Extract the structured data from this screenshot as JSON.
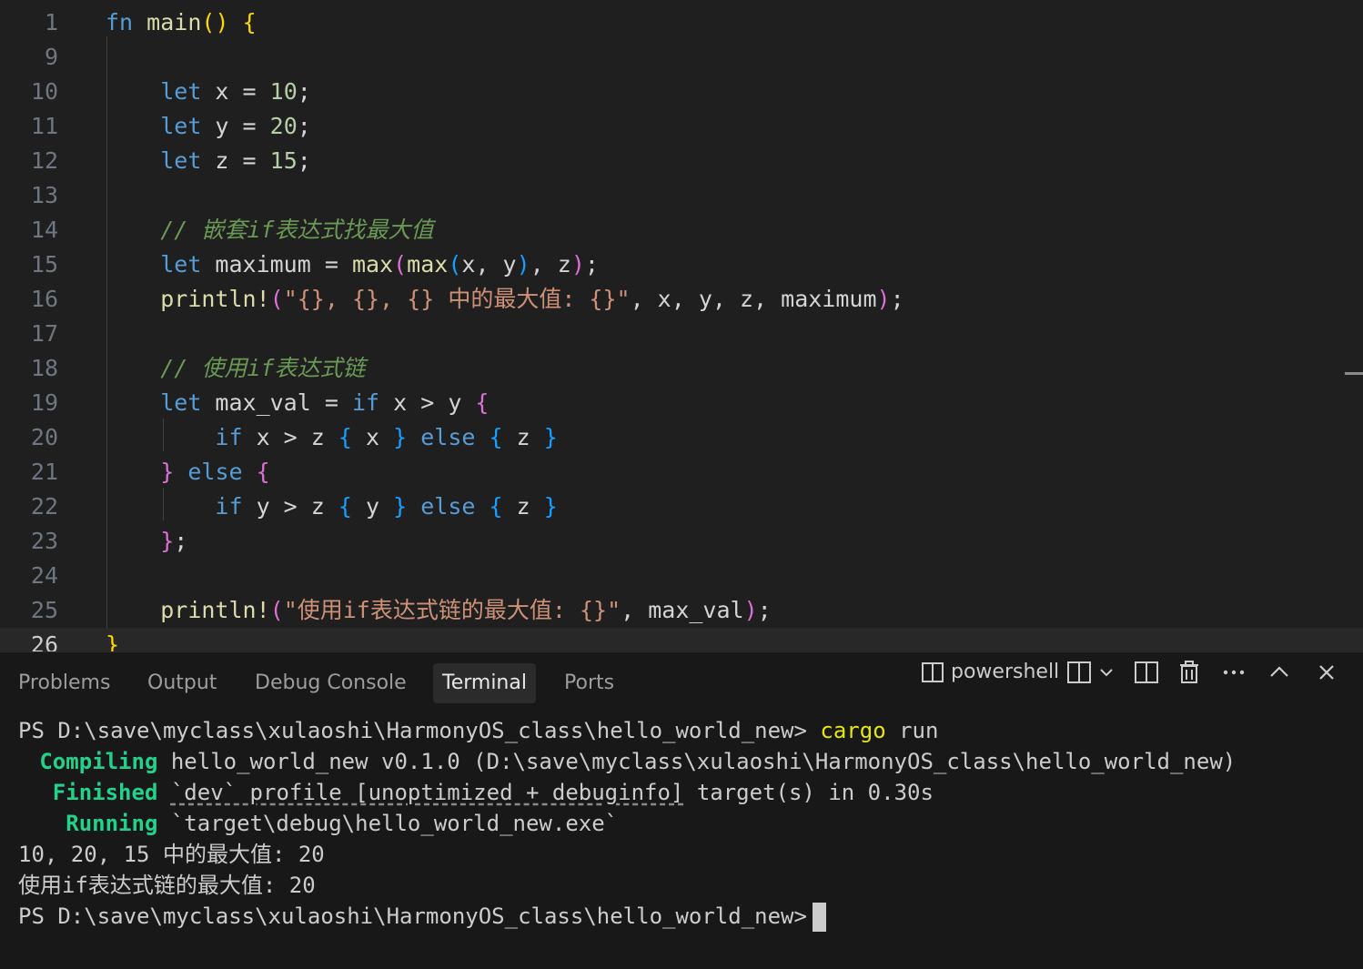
{
  "editor": {
    "lines": [
      {
        "n": "1",
        "code": [
          [
            "kw",
            "fn"
          ],
          [
            "id",
            " "
          ],
          [
            "fn",
            "main"
          ],
          [
            "b1",
            "()"
          ],
          [
            "id",
            " "
          ],
          [
            "b1",
            "{"
          ]
        ]
      },
      {
        "n": "9",
        "code": []
      },
      {
        "n": "10",
        "code": [
          [
            "id",
            "    "
          ],
          [
            "kw",
            "let"
          ],
          [
            "id",
            " x = "
          ],
          [
            "num",
            "10"
          ],
          [
            "punc",
            ";"
          ]
        ]
      },
      {
        "n": "11",
        "code": [
          [
            "id",
            "    "
          ],
          [
            "kw",
            "let"
          ],
          [
            "id",
            " y = "
          ],
          [
            "num",
            "20"
          ],
          [
            "punc",
            ";"
          ]
        ]
      },
      {
        "n": "12",
        "code": [
          [
            "id",
            "    "
          ],
          [
            "kw",
            "let"
          ],
          [
            "id",
            " z = "
          ],
          [
            "num",
            "15"
          ],
          [
            "punc",
            ";"
          ]
        ]
      },
      {
        "n": "13",
        "code": []
      },
      {
        "n": "14",
        "code": [
          [
            "id",
            "    "
          ],
          [
            "cm",
            "// 嵌套if表达式找最大值"
          ]
        ]
      },
      {
        "n": "15",
        "code": [
          [
            "id",
            "    "
          ],
          [
            "kw",
            "let"
          ],
          [
            "id",
            " maximum = "
          ],
          [
            "fn",
            "max"
          ],
          [
            "b2",
            "("
          ],
          [
            "fn",
            "max"
          ],
          [
            "b3",
            "("
          ],
          [
            "id",
            "x, y"
          ],
          [
            "b3",
            ")"
          ],
          [
            "id",
            ", z"
          ],
          [
            "b2",
            ")"
          ],
          [
            "punc",
            ";"
          ]
        ]
      },
      {
        "n": "16",
        "code": [
          [
            "id",
            "    "
          ],
          [
            "mac",
            "println!"
          ],
          [
            "b2",
            "("
          ],
          [
            "str",
            "\"{}, {}, {} 中的最大值: {}\""
          ],
          [
            "id",
            ", x, y, z, maximum"
          ],
          [
            "b2",
            ")"
          ],
          [
            "punc",
            ";"
          ]
        ]
      },
      {
        "n": "17",
        "code": []
      },
      {
        "n": "18",
        "code": [
          [
            "id",
            "    "
          ],
          [
            "cm",
            "// 使用if表达式链"
          ]
        ]
      },
      {
        "n": "19",
        "code": [
          [
            "id",
            "    "
          ],
          [
            "kw",
            "let"
          ],
          [
            "id",
            " max_val = "
          ],
          [
            "kw",
            "if"
          ],
          [
            "id",
            " x > y "
          ],
          [
            "b2",
            "{"
          ]
        ]
      },
      {
        "n": "20",
        "code": [
          [
            "id",
            "        "
          ],
          [
            "kw",
            "if"
          ],
          [
            "id",
            " x > z "
          ],
          [
            "b3",
            "{"
          ],
          [
            "id",
            " x "
          ],
          [
            "b3",
            "}"
          ],
          [
            "id",
            " "
          ],
          [
            "kw",
            "else"
          ],
          [
            "id",
            " "
          ],
          [
            "b3",
            "{"
          ],
          [
            "id",
            " z "
          ],
          [
            "b3",
            "}"
          ]
        ]
      },
      {
        "n": "21",
        "code": [
          [
            "id",
            "    "
          ],
          [
            "b2",
            "}"
          ],
          [
            "id",
            " "
          ],
          [
            "kw",
            "else"
          ],
          [
            "id",
            " "
          ],
          [
            "b2",
            "{"
          ]
        ]
      },
      {
        "n": "22",
        "code": [
          [
            "id",
            "        "
          ],
          [
            "kw",
            "if"
          ],
          [
            "id",
            " y > z "
          ],
          [
            "b3",
            "{"
          ],
          [
            "id",
            " y "
          ],
          [
            "b3",
            "}"
          ],
          [
            "id",
            " "
          ],
          [
            "kw",
            "else"
          ],
          [
            "id",
            " "
          ],
          [
            "b3",
            "{"
          ],
          [
            "id",
            " z "
          ],
          [
            "b3",
            "}"
          ]
        ]
      },
      {
        "n": "23",
        "code": [
          [
            "id",
            "    "
          ],
          [
            "b2",
            "}"
          ],
          [
            "punc",
            ";"
          ]
        ]
      },
      {
        "n": "24",
        "code": []
      },
      {
        "n": "25",
        "code": [
          [
            "id",
            "    "
          ],
          [
            "mac",
            "println!"
          ],
          [
            "b2",
            "("
          ],
          [
            "str",
            "\"使用if表达式链的最大值: {}\""
          ],
          [
            "id",
            ", max_val"
          ],
          [
            "b2",
            ")"
          ],
          [
            "punc",
            ";"
          ]
        ]
      },
      {
        "n": "26",
        "code": [
          [
            "b1",
            "}"
          ]
        ],
        "current": true
      }
    ]
  },
  "panel": {
    "tabs": [
      {
        "label": "Problems",
        "active": false
      },
      {
        "label": "Output",
        "active": false
      },
      {
        "label": "Debug Console",
        "active": false
      },
      {
        "label": "Terminal",
        "active": true
      },
      {
        "label": "Ports",
        "active": false
      }
    ],
    "shell_label": "powershell"
  },
  "terminal": {
    "prompt": "PS D:\\save\\myclass\\xulaoshi\\HarmonyOS_class\\hello_world_new>",
    "command_1": "cargo",
    "command_2": " run",
    "compiling_label": "   Compiling",
    "compiling_text": " hello_world_new v0.1.0 (D:\\save\\myclass\\xulaoshi\\HarmonyOS_class\\hello_world_new)",
    "finished_label": "    Finished",
    "finished_underlined": "`dev` profile [unoptimized + debuginfo]",
    "finished_rest": " target(s) in 0.30s",
    "running_label": "     Running",
    "running_text": " `target\\debug\\hello_world_new.exe`",
    "output_1": "10, 20, 15 中的最大值: 20",
    "output_2": "使用if表达式链的最大值: 20",
    "prompt_2": "PS D:\\save\\myclass\\xulaoshi\\HarmonyOS_class\\hello_world_new>"
  }
}
